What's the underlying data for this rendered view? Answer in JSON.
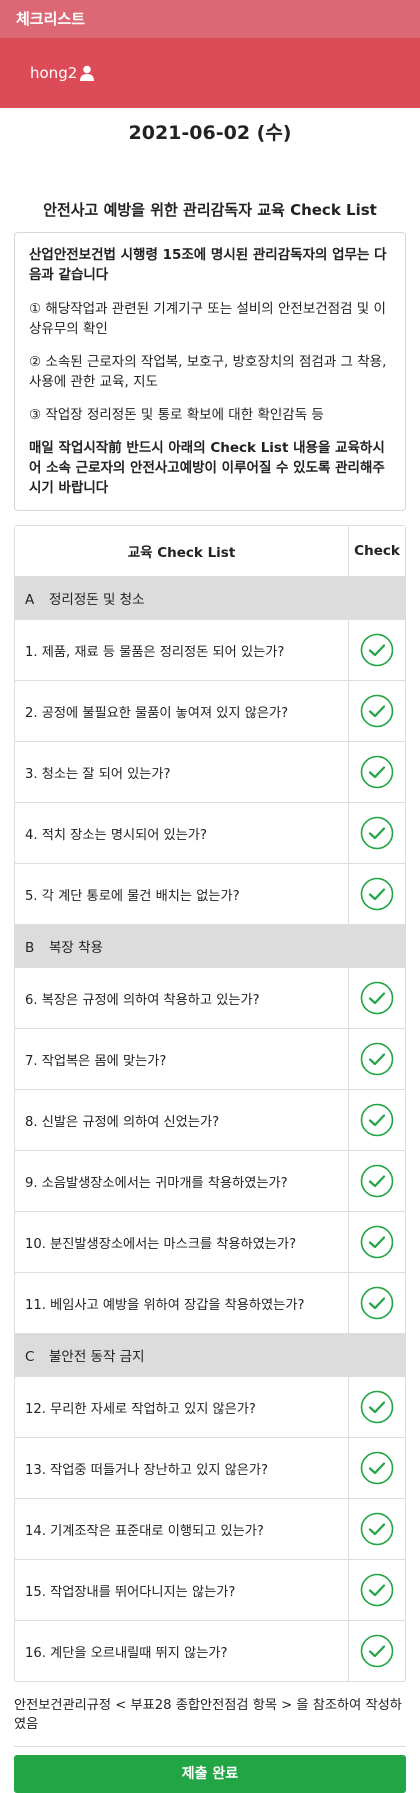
{
  "topbar": {
    "title": "체크리스트"
  },
  "user": {
    "name": "hong2",
    "icon": "user-icon"
  },
  "date": "2021-06-02 (수)",
  "page_title": "안전사고 예방을 위한 관리감독자 교육 Check List",
  "notice": {
    "intro": "산업안전보건법 시행령 15조에 명시된 관리감독자의 업무는 다음과 같습니다",
    "items": [
      "① 해당작업과 관련된 기계기구 또는 설비의 안전보건점검 및 이상유무의 확인",
      "② 소속된 근로자의 작업복, 보호구, 방호장치의 점검과 그 착용, 사용에 관한 교육, 지도",
      "③ 작업장 정리정돈 및 통로 확보에 대한 확인감독 등"
    ],
    "closing": "매일 작업시작前 반드시 아래의 Check List 내용을 교육하시어 소속 근로자의 안전사고예방이 이루어질 수 있도록 관리해주시기 바랍니다"
  },
  "table": {
    "header_question": "교육 Check List",
    "header_check": "Check",
    "sections": [
      {
        "letter": "A",
        "name": "정리정돈 및 청소",
        "items": [
          "1. 제품, 재료 등 물품은 정리정돈 되어 있는가?",
          "2. 공정에 불필요한 물품이 놓여져 있지 않은가?",
          "3. 청소는 잘 되어 있는가?",
          "4. 적치 장소는 명시되어 있는가?",
          "5. 각 계단 통로에 물건 배치는 없는가?"
        ]
      },
      {
        "letter": "B",
        "name": "복장 착용",
        "items": [
          "6. 복장은 규정에 의하여 착용하고 있는가?",
          "7. 작업복은 몸에 맞는가?",
          "8. 신발은 규정에 의하여 신었는가?",
          "9. 소음발생장소에서는 귀마개를 착용하였는가?",
          "10. 분진발생장소에서는 마스크를 착용하였는가?",
          "11. 베임사고 예방을 위하여 장갑을 착용하였는가?"
        ]
      },
      {
        "letter": "C",
        "name": "불안전 동작 금지",
        "items": [
          "12. 무리한 자세로 작업하고 있지 않은가?",
          "13. 작업중 떠들거나 장난하고 있지 않은가?",
          "14. 기계조작은 표준대로 이행되고 있는가?",
          "15. 작업장내를 뛰어다니지는 않는가?",
          "16. 계단을 오르내릴때 뛰지 않는가?"
        ]
      }
    ]
  },
  "footer_note": "안전보건관리규정 < 부표28 종합안전점검 항목 > 을 참조하여 작성하였음",
  "submit_label": "제출 완료",
  "colors": {
    "topbar": "#dc6875",
    "userbar": "#dd4b58",
    "check": "#21a545",
    "submit": "#21a545"
  }
}
